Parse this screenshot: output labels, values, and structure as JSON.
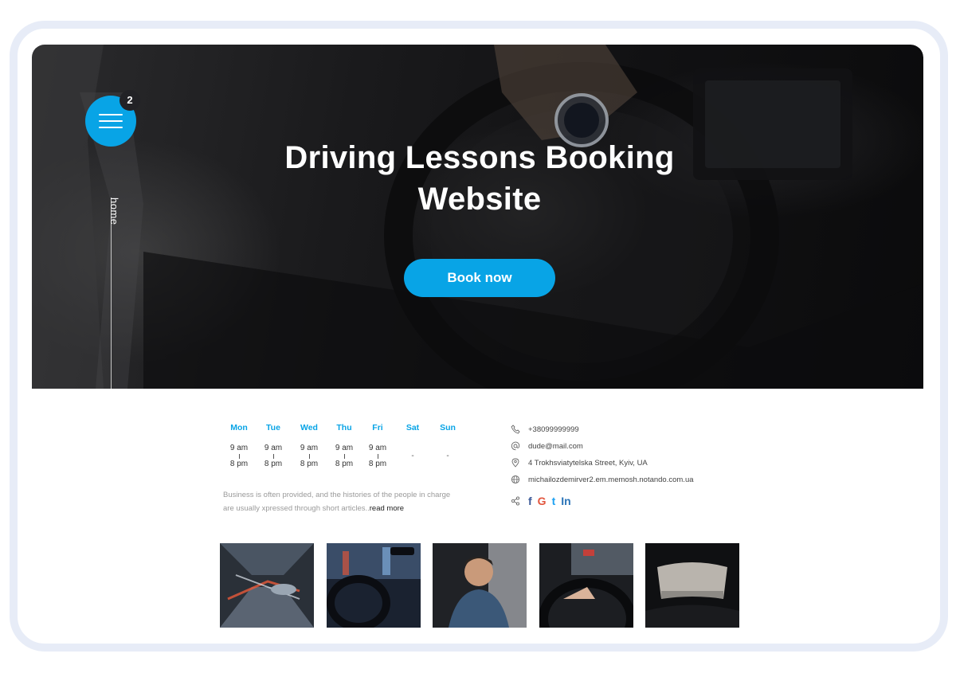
{
  "hero": {
    "title": "Driving Lessons Booking Website",
    "button_label": "Book now",
    "menu_badge": "2",
    "nav_label": "home"
  },
  "schedule": {
    "days": [
      {
        "name": "Mon",
        "open": "9 am",
        "close": "8 pm"
      },
      {
        "name": "Tue",
        "open": "9 am",
        "close": "8 pm"
      },
      {
        "name": "Wed",
        "open": "9 am",
        "close": "8 pm"
      },
      {
        "name": "Thu",
        "open": "9 am",
        "close": "8 pm"
      },
      {
        "name": "Fri",
        "open": "9 am",
        "close": "8 pm"
      },
      {
        "name": "Sat",
        "closed": "-"
      },
      {
        "name": "Sun",
        "closed": "-"
      }
    ]
  },
  "description": {
    "text": "Business is often provided, and the histories of the people in charge are usually xpressed through short articles..",
    "link": "read more"
  },
  "contacts": {
    "phone": "+38099999999",
    "email": "dude@mail.com",
    "address": "4 Trokhsviatytelska Street, Kyiv, UA",
    "website": "michailozdemirver2.em.memosh.notando.com.ua"
  },
  "social": [
    {
      "icon": "facebook-icon",
      "glyph": "f",
      "color": "#3b5998"
    },
    {
      "icon": "google-icon",
      "glyph": "G",
      "color": "#e2553d"
    },
    {
      "icon": "tumblr-icon",
      "glyph": "t",
      "color": "#1da1f2"
    },
    {
      "icon": "linkedin-icon",
      "glyph": "In",
      "color": "#2a74b8"
    }
  ],
  "colors": {
    "accent": "#08a4e6",
    "frame": "#e7ecf7"
  }
}
